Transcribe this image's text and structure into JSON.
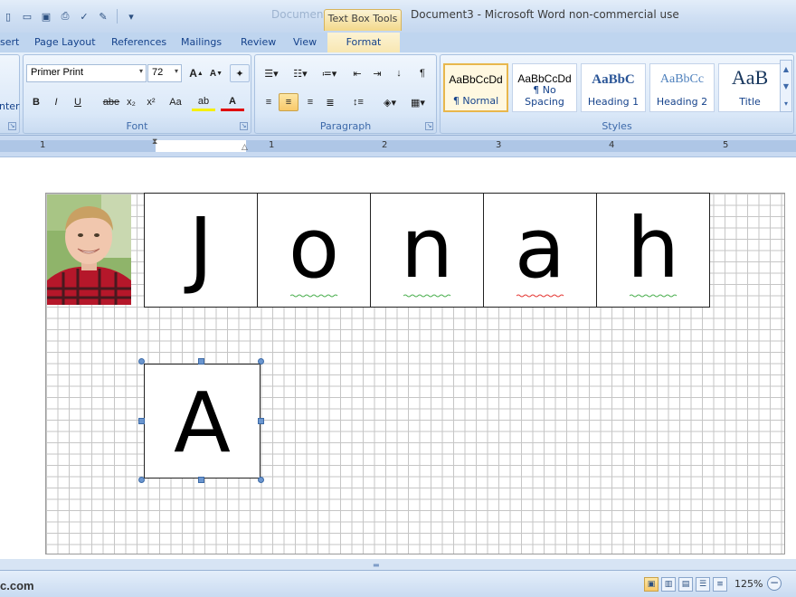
{
  "titlebar": {
    "ghost_text": "Document3",
    "contextual_tab": "Text Box Tools",
    "document_title": "Document3 - Microsoft Word non-commercial use",
    "qat_icons": [
      "new-icon",
      "open-icon",
      "save-icon",
      "print-preview-icon",
      "spelling-icon",
      "edit-icon",
      "customize-icon"
    ]
  },
  "tabs": {
    "insert": "sert",
    "page_layout": "Page Layout",
    "references": "References",
    "mailings": "Mailings",
    "review": "Review",
    "view": "View",
    "format": "Format"
  },
  "ribbon": {
    "clipboard_partial": "nter",
    "font_group": {
      "label": "Font",
      "font_name": "Primer Print",
      "font_size": "72",
      "grow": "A",
      "shrink": "A",
      "bold": "B",
      "italic": "I",
      "underline": "U",
      "strikethrough": "abe",
      "subscript": "x₂",
      "superscript": "x²",
      "change_case": "Aa",
      "highlight": "ab",
      "font_color": "A"
    },
    "paragraph_group": {
      "label": "Paragraph",
      "show_marks": "¶",
      "sort": "↓"
    },
    "styles_group": {
      "label": "Styles",
      "items": [
        {
          "sample": "AaBbCcDd",
          "name": "¶ Normal"
        },
        {
          "sample": "AaBbCcDd",
          "name": "¶ No Spacing"
        },
        {
          "sample": "AaBbC",
          "name": "Heading 1"
        },
        {
          "sample": "AaBbCc",
          "name": "Heading 2"
        },
        {
          "sample": "AaB",
          "name": "Title"
        }
      ]
    }
  },
  "ruler": {
    "numbers": [
      "1",
      "1",
      "2",
      "3",
      "4",
      "5"
    ]
  },
  "document": {
    "name_letters": [
      "J",
      "o",
      "n",
      "a",
      "h"
    ],
    "textbox_letter": "A"
  },
  "statusbar": {
    "watermark": "c.com",
    "zoom_level": "125%",
    "zoom_out": "−"
  },
  "colors": {
    "ribbon_text": "#15428b",
    "selection_orange": "#f8c96a",
    "handle_blue": "#6b96cf",
    "spell_green": "#4caf50",
    "spell_red": "#e53935"
  }
}
